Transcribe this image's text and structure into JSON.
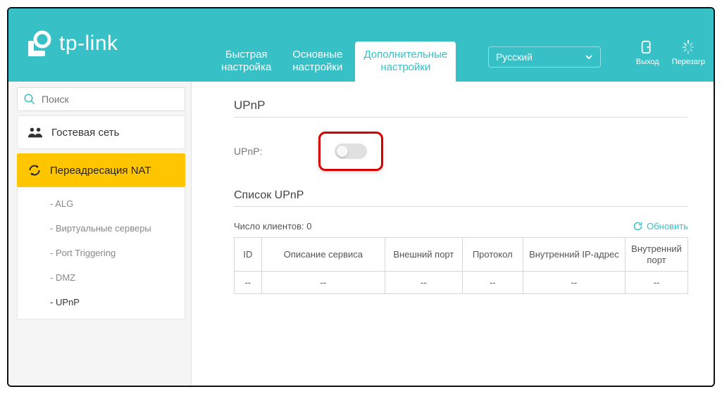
{
  "brand": "tp-link",
  "header": {
    "tabs": [
      {
        "label": "Быстрая\nнастройка"
      },
      {
        "label": "Основные\nнастройки"
      },
      {
        "label": "Дополнительные\nнастройки"
      }
    ],
    "language": "Русский",
    "exit": "Выход",
    "reload": "Перезагр"
  },
  "sidebar": {
    "search_placeholder": "Поиск",
    "guest": "Гостевая сеть",
    "nat": "Переадресация NAT",
    "sub": {
      "alg": "ALG",
      "vservers": "Виртуальные серверы",
      "ptrig": "Port Triggering",
      "dmz": "DMZ",
      "upnp": "UPnP"
    }
  },
  "main": {
    "upnp_title": "UPnP",
    "upnp_label": "UPnP:",
    "list_title": "Список UPnP",
    "clients_label": "Число клиентов: 0",
    "refresh": "Обновить",
    "table": {
      "headers": {
        "id": "ID",
        "desc": "Описание сервиса",
        "ext_port": "Внешний порт",
        "proto": "Протокол",
        "int_ip": "Внутренний IP-адрес",
        "int_port": "Внутренний\nпорт"
      },
      "empty": "--"
    }
  }
}
